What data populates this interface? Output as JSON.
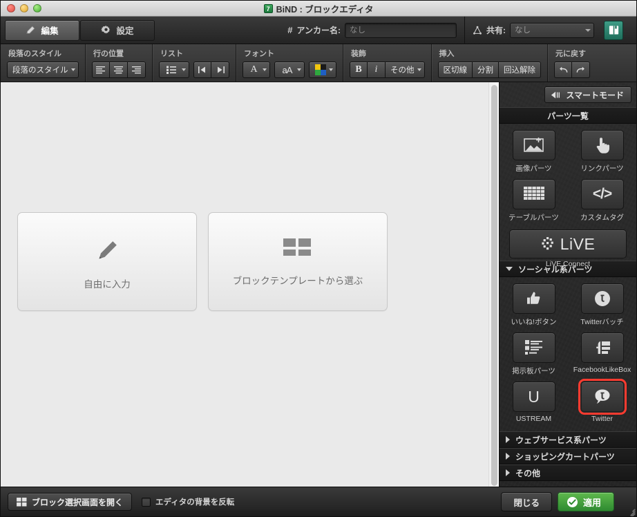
{
  "window": {
    "title": "BiND : ブロックエディタ",
    "app_badge": "7",
    "traffic_lights": [
      "close-button",
      "minimize-button",
      "zoom-button"
    ]
  },
  "tabs": [
    {
      "label": "編集",
      "icon": "pencil-icon",
      "active": true
    },
    {
      "label": "設定",
      "icon": "gear-icon",
      "active": false
    }
  ],
  "tabbar": {
    "anchor": {
      "hash": "#",
      "label": "アンカー名:",
      "value": "なし"
    },
    "share": {
      "icon": "share-icon",
      "label": "共有:",
      "value": "なし"
    },
    "book_button": {
      "icon": "book-icon"
    }
  },
  "format_toolbar": {
    "sections": [
      {
        "title": "段落のスタイル",
        "controls": [
          {
            "type": "dropdown",
            "label": "段落のスタイル"
          }
        ]
      },
      {
        "title": "行の位置",
        "controls": [
          {
            "type": "icon",
            "name": "align-left-icon"
          },
          {
            "type": "icon",
            "name": "align-center-icon"
          },
          {
            "type": "icon",
            "name": "align-right-icon"
          }
        ]
      },
      {
        "title": "リスト",
        "controls": [
          {
            "type": "icon-dropdown",
            "name": "bullet-list-icon"
          },
          {
            "type": "icon",
            "name": "outdent-icon"
          },
          {
            "type": "icon",
            "name": "indent-icon"
          }
        ]
      },
      {
        "title": "フォント",
        "controls": [
          {
            "type": "icon-dropdown",
            "name": "font-family-icon",
            "glyph": "A"
          },
          {
            "type": "icon-dropdown",
            "name": "font-size-icon",
            "glyph": "aA"
          },
          {
            "type": "icon-dropdown",
            "name": "font-color-icon"
          }
        ]
      },
      {
        "title": "装飾",
        "controls": [
          {
            "type": "text",
            "label": "B",
            "name": "bold-button"
          },
          {
            "type": "text",
            "label": "i",
            "name": "italic-button"
          },
          {
            "type": "text-dropdown",
            "label": "その他",
            "name": "more-decoration-button"
          }
        ]
      },
      {
        "title": "挿入",
        "controls": [
          {
            "type": "text",
            "label": "区切線",
            "name": "divider-button"
          },
          {
            "type": "text",
            "label": "分割",
            "name": "split-button"
          },
          {
            "type": "text",
            "label": "回込解除",
            "name": "clear-float-button"
          }
        ]
      },
      {
        "title": "元に戻す",
        "controls": [
          {
            "type": "icon",
            "name": "undo-icon"
          },
          {
            "type": "icon",
            "name": "redo-icon"
          }
        ]
      }
    ],
    "swatch_colors": [
      "#f2c60f",
      "#1a1a1a",
      "#2fa83f",
      "#1f5fc4"
    ]
  },
  "canvas": {
    "cards": [
      {
        "label": "自由に入力",
        "icon": "pencil-icon"
      },
      {
        "label": "ブロックテンプレートから選ぶ",
        "icon": "grid-blocks-icon"
      }
    ]
  },
  "sidebar": {
    "smart_mode": {
      "label": "スマートモード",
      "icon": "collapse-left-icon"
    },
    "parts_header": "パーツ一覧",
    "basic_parts": [
      {
        "label": "画像パーツ",
        "icon": "image-add-icon"
      },
      {
        "label": "リンクパーツ",
        "icon": "hand-pointer-icon"
      },
      {
        "label": "テーブルパーツ",
        "icon": "table-grid-icon"
      },
      {
        "label": "カスタムタグ",
        "icon": "code-tag-icon"
      }
    ],
    "live_part": {
      "label": "LiVE Connect",
      "icon": "live-dots-icon",
      "text": "LiVE"
    },
    "social_section": {
      "label": "ソーシャル系パーツ",
      "expanded": true
    },
    "social_parts": [
      {
        "label": "いいね!ボタン",
        "icon": "thumbs-up-icon",
        "selected": false
      },
      {
        "label": "Twitterバッチ",
        "icon": "twitter-badge-icon",
        "selected": false
      },
      {
        "label": "掲示板パーツ",
        "icon": "bulletin-board-icon",
        "selected": false
      },
      {
        "label": "FacebookLikeBox",
        "icon": "facebook-icon",
        "selected": false
      },
      {
        "label": "USTREAM",
        "icon": "ustream-icon",
        "selected": false
      },
      {
        "label": "Twitter",
        "icon": "twitter-bubble-icon",
        "selected": true
      }
    ],
    "collapsed_sections": [
      {
        "label": "ウェブサービス系パーツ"
      },
      {
        "label": "ショッピングカートパーツ"
      },
      {
        "label": "その他"
      }
    ],
    "selection_color": "#ff3b30"
  },
  "bottom_bar": {
    "open_block_button": {
      "label": "ブロック選択画面を開く",
      "icon": "grid-blocks-icon"
    },
    "invert_checkbox": {
      "label": "エディタの背景を反転",
      "checked": false
    },
    "close_button": "閉じる",
    "apply_button": {
      "label": "適用",
      "icon": "check-circle-icon",
      "color": "#3e9c3f"
    }
  }
}
